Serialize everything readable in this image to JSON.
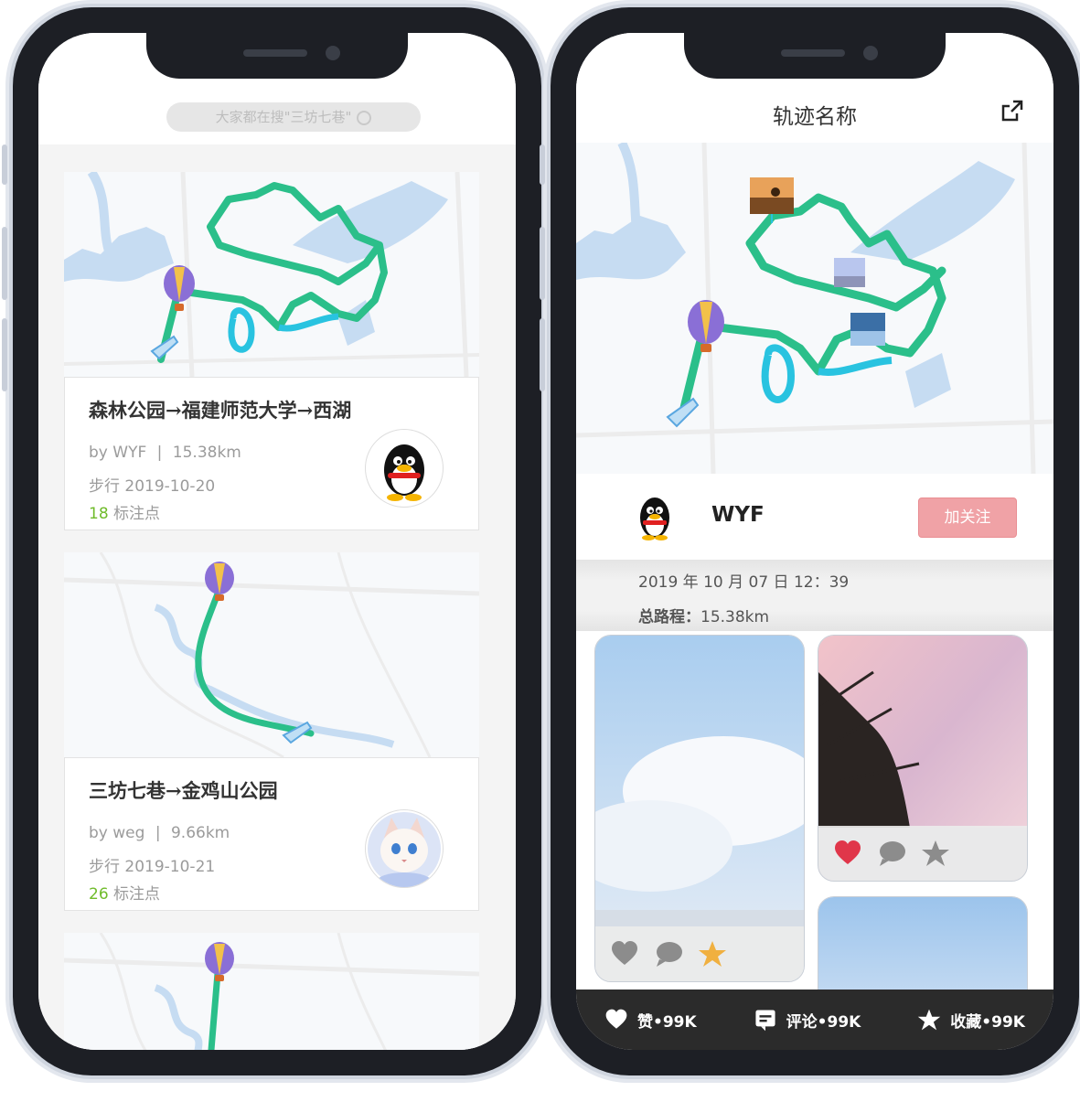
{
  "left_screen": {
    "search": {
      "placeholder": "大家都在搜\"三坊七巷\""
    },
    "cards": [
      {
        "title": "森林公园→福建师范大学→西湖",
        "author": "by WYF",
        "separator": "|",
        "distance": "15.38km",
        "mode_date": "步行 2019-10-20",
        "marker_count": "18",
        "marker_label": "标注点",
        "avatar_icon": "penguin-avatar-icon"
      },
      {
        "title": "三坊七巷→金鸡山公园",
        "author": "by weg",
        "separator": "|",
        "distance": "9.66km",
        "mode_date": "步行 2019-10-21",
        "marker_count": "26",
        "marker_label": "标注点",
        "avatar_icon": "cat-avatar-icon"
      }
    ]
  },
  "right_screen": {
    "header": {
      "title": "轨迹名称",
      "share_icon": "share-icon"
    },
    "user": {
      "name": "WYF",
      "follow_label": "加关注"
    },
    "info": {
      "date": "2019 年 10 月 07 日 12：39",
      "distance_label": "总路程：",
      "distance_value": "15.38km"
    },
    "bottom_bar": {
      "like_label": "赞•99K",
      "comment_label": "评论•99K",
      "favorite_label": "收藏•99K"
    }
  },
  "colors": {
    "route_green": "#2bbf8a",
    "route_cyan": "#29c3e0",
    "water": "#c6dcf2",
    "follow_button": "#f0a2a6",
    "marker_count": "#6fbb2a",
    "bottom_bar": "#2b2b2b"
  }
}
